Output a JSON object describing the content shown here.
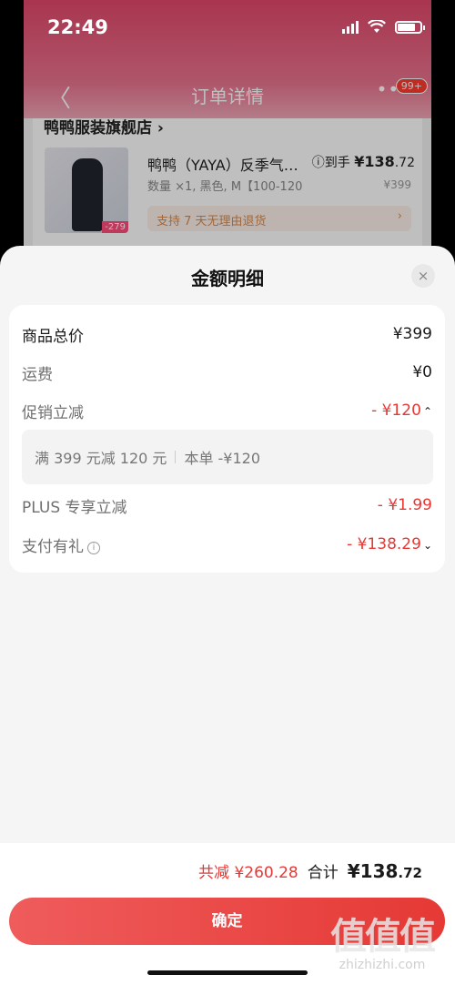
{
  "status_bar": {
    "time": "22:49"
  },
  "background_page": {
    "nav_title": "订单详情",
    "back": "〈",
    "more": "•••",
    "badge": "99+",
    "store_name": "鸭鸭服装旗舰店 ›",
    "product_name": "鸭鸭（YAYA）反季气…",
    "product_meta": "数量 ×1, 黑色, M【100-120",
    "to_hand_label": "ⓘ到手",
    "to_hand_price_int": "¥138",
    "to_hand_price_dec": ".72",
    "original_price": "¥399",
    "return_policy": "支持 7 天无理由退货",
    "thumb_price": "-279"
  },
  "sheet": {
    "title": "金额明细",
    "close_icon": "×",
    "rows": [
      {
        "label": "商品总价",
        "value": "¥399"
      },
      {
        "label": "运费",
        "value": "¥0"
      },
      {
        "label": "促销立减",
        "value": "- ¥120",
        "chevron": "⌃"
      },
      {
        "label": "PLUS 专享立减",
        "value": "- ¥1.99"
      },
      {
        "label": "支付有礼",
        "value": "- ¥138.29",
        "chevron": "⌄"
      }
    ],
    "promo_detail": {
      "rule": "满 399 元减 120 元",
      "this_order": "本单 -¥120"
    }
  },
  "footer": {
    "saved_text": "共减 ¥260.28",
    "sum_label": "合计",
    "sum_int": "¥138",
    "sum_dec": ".72",
    "confirm": "确定"
  },
  "watermark": {
    "big": "值值值",
    "small": "zhizhizhi.com"
  },
  "colors": {
    "accent_red": "#e53935",
    "header_pink": "#e2476a"
  }
}
